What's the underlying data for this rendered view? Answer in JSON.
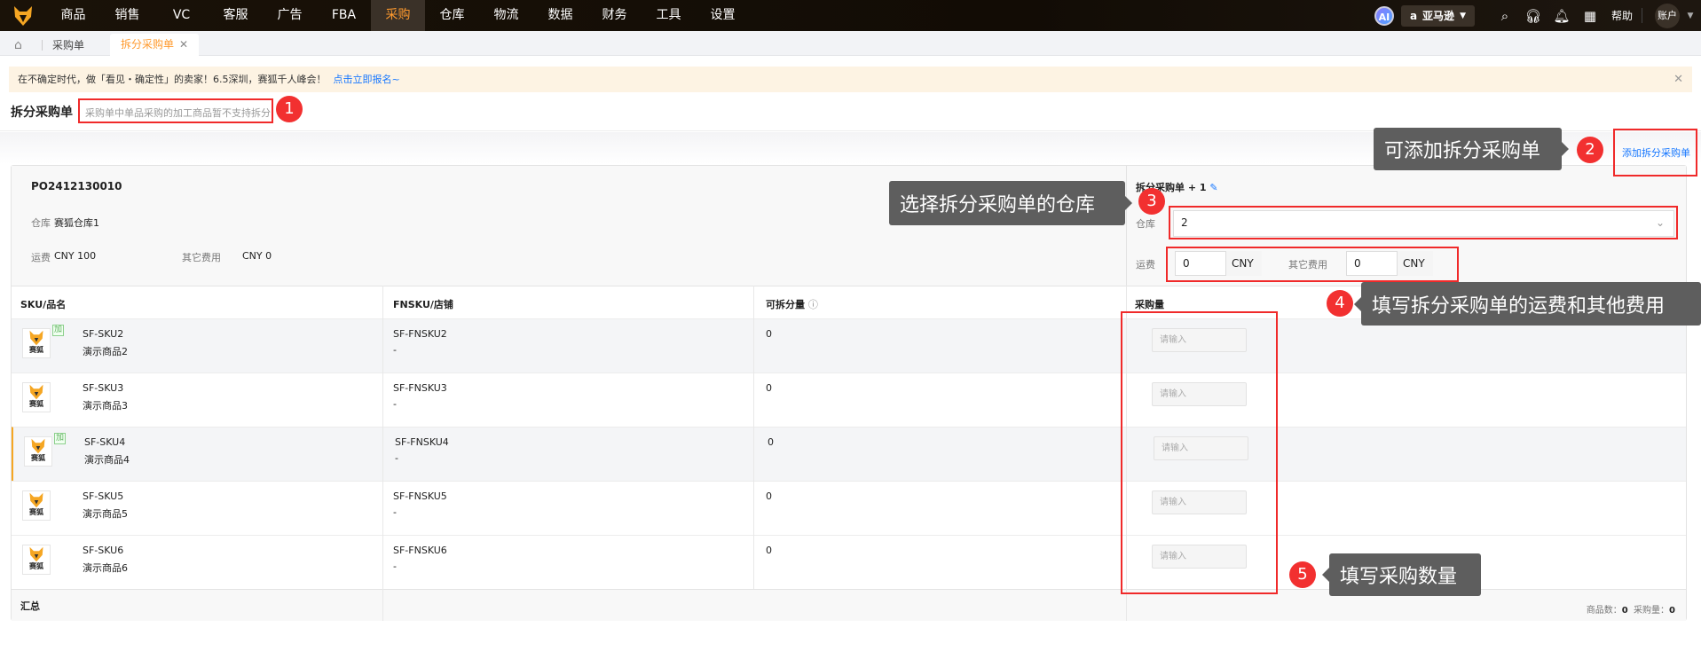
{
  "nav": {
    "items": [
      "商品",
      "销售",
      "VC",
      "客服",
      "广告",
      "FBA",
      "采购",
      "仓库",
      "物流",
      "数据",
      "财务",
      "工具",
      "设置"
    ],
    "active": "采购",
    "ai": "AI",
    "marketplace": "亚马逊",
    "help": "帮助",
    "account": "账户"
  },
  "tabs": {
    "items": [
      {
        "label": "采购单"
      },
      {
        "label": "拆分采购单"
      }
    ]
  },
  "banner": {
    "text": "在不确定时代，做「看见・确定性」的卖家！6.5深圳，赛狐千人峰会！",
    "link": "点击立即报名~"
  },
  "page": {
    "title": "拆分采购单",
    "hint": "采购单中单品采购的加工商品暂不支持拆分",
    "add_link": "添加拆分采购单"
  },
  "order": {
    "po": "PO2412130010",
    "warehouse_label": "仓库",
    "warehouse": "赛狐仓库1",
    "freight_label": "运费",
    "freight": "CNY 100",
    "other_label": "其它费用",
    "other": "CNY 0"
  },
  "split": {
    "title": "拆分采购单 + 1",
    "warehouse_label": "仓库",
    "warehouse_value": "2",
    "freight_label": "运费",
    "freight_value": "0",
    "currency": "CNY",
    "other_label": "其它费用",
    "other_value": "0"
  },
  "table": {
    "headers": [
      "SKU/品名",
      "FNSKU/店铺",
      "可拆分量",
      "采购量"
    ],
    "rows": [
      {
        "sku": "SF-SKU2",
        "name": "演示商品2",
        "fnsku": "SF-FNSKU2",
        "shop": "-",
        "splittable": "0",
        "tag": "加"
      },
      {
        "sku": "SF-SKU3",
        "name": "演示商品3",
        "fnsku": "SF-FNSKU3",
        "shop": "-",
        "splittable": "0",
        "tag": ""
      },
      {
        "sku": "SF-SKU4",
        "name": "演示商品4",
        "fnsku": "SF-FNSKU4",
        "shop": "-",
        "splittable": "0",
        "tag": "加"
      },
      {
        "sku": "SF-SKU5",
        "name": "演示商品5",
        "fnsku": "SF-FNSKU5",
        "shop": "-",
        "splittable": "0",
        "tag": ""
      },
      {
        "sku": "SF-SKU6",
        "name": "演示商品6",
        "fnsku": "SF-FNSKU6",
        "shop": "-",
        "splittable": "0",
        "tag": ""
      }
    ],
    "qty_placeholder": "请输入",
    "thumb_text": "赛狐",
    "summary_label": "汇总",
    "count_label": "商品数：",
    "count": "0",
    "qty_label": "采购量：",
    "qty": "0"
  },
  "annotations": [
    {
      "num": "1"
    },
    {
      "num": "2",
      "text": "可添加拆分采购单"
    },
    {
      "num": "3",
      "text": "选择拆分采购单的仓库"
    },
    {
      "num": "4",
      "text": "填写拆分采购单的运费和其他费用"
    },
    {
      "num": "5",
      "text": "填写采购数量"
    }
  ],
  "colors": {
    "accent": "#ff9a2e",
    "link": "#1677ff",
    "annotation_red": "#f02a2a",
    "tooltip": "#5e5e5e"
  }
}
